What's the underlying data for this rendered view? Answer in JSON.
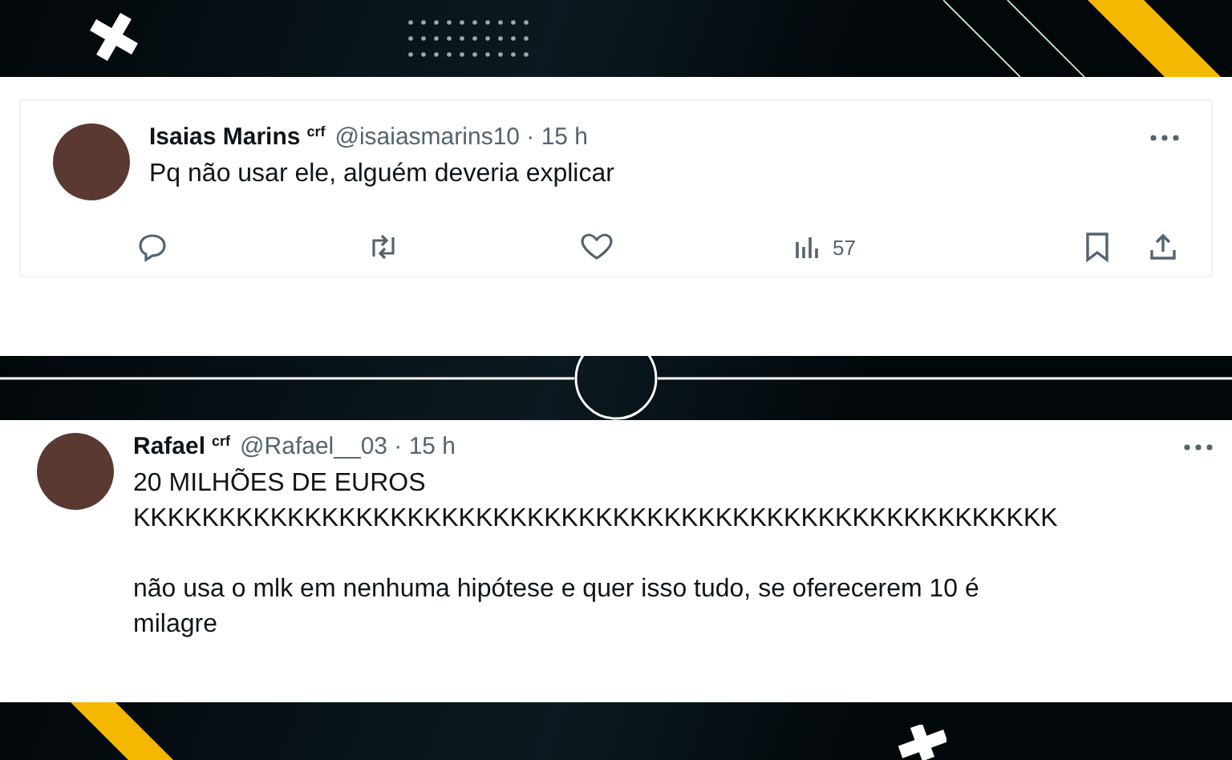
{
  "tweets": [
    {
      "name": "Isaias Marins",
      "badge": "crf",
      "meta": "@isaiasmarins10 · 15 h",
      "paragraphs": [
        [
          "Pq não usar ele, alguém deveria explicar"
        ]
      ],
      "actions": {
        "views": "57"
      }
    },
    {
      "name": "Rafael",
      "badge": "crf",
      "meta": "@Rafael__03 · 15 h",
      "paragraphs": [
        [
          "20 MILHÕES DE EUROS",
          "KKKKKKKKKKKKKKKKKKKKKKKKKKKKKKKKKKKKKKKKKKKKKKKKKKKKKK"
        ],
        [
          "não usa o mlk em nenhuma hipótese e quer isso tudo, se oferecerem 10 é",
          "milagre"
        ]
      ]
    }
  ]
}
